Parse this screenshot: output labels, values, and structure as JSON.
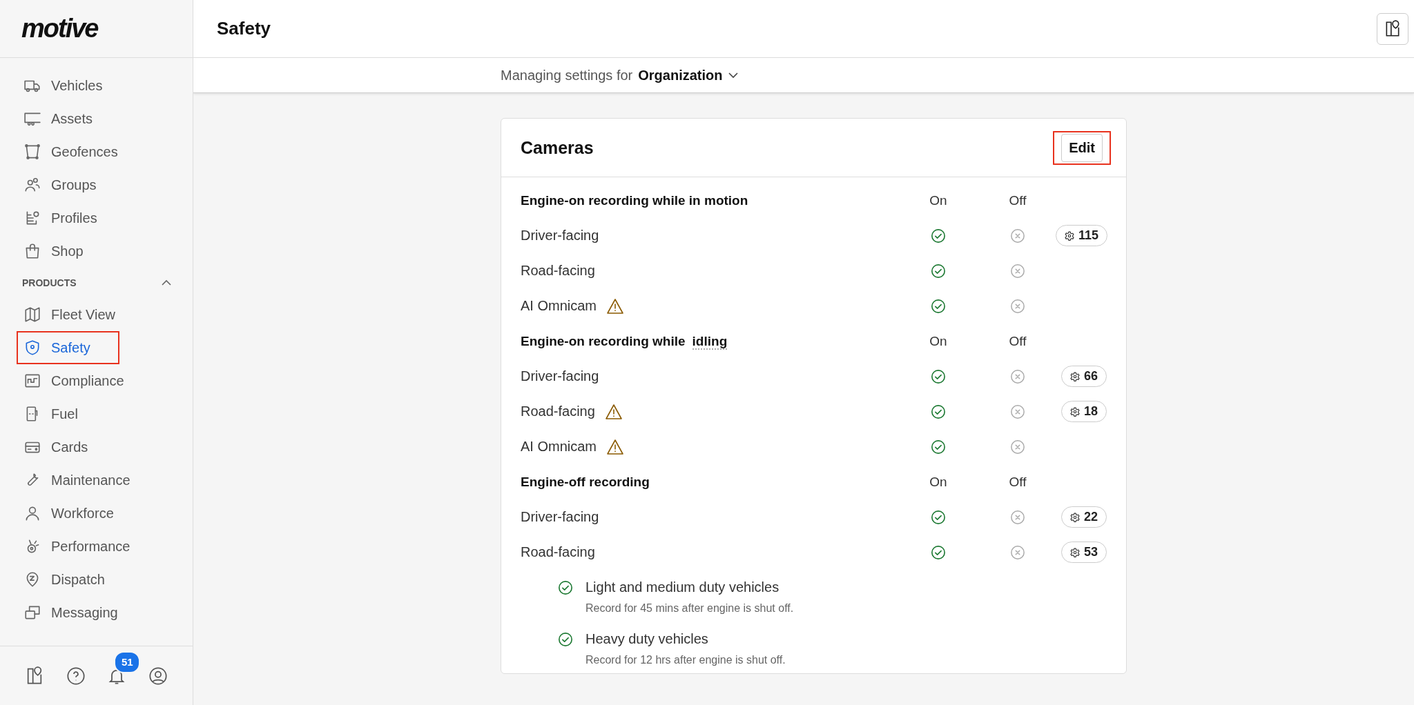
{
  "sidebar": {
    "logo": "motive",
    "items": [
      {
        "label": "Vehicles",
        "selected": false,
        "highlighted": false
      },
      {
        "label": "Assets",
        "selected": false,
        "highlighted": false
      },
      {
        "label": "Geofences",
        "selected": false,
        "highlighted": false
      },
      {
        "label": "Groups",
        "selected": false,
        "highlighted": false
      },
      {
        "label": "Profiles",
        "selected": false,
        "highlighted": false
      },
      {
        "label": "Shop",
        "selected": false,
        "highlighted": false
      }
    ],
    "section": {
      "title": "PRODUCTS",
      "expanded": true
    },
    "products": [
      {
        "label": "Fleet View",
        "selected": false,
        "highlighted": false
      },
      {
        "label": "Safety",
        "selected": true,
        "highlighted": true
      },
      {
        "label": "Compliance",
        "selected": false,
        "highlighted": false
      },
      {
        "label": "Fuel",
        "selected": false,
        "highlighted": false
      },
      {
        "label": "Cards",
        "selected": false,
        "highlighted": false
      },
      {
        "label": "Maintenance",
        "selected": false,
        "highlighted": false
      },
      {
        "label": "Workforce",
        "selected": false,
        "highlighted": false
      },
      {
        "label": "Performance",
        "selected": false,
        "highlighted": false
      },
      {
        "label": "Dispatch",
        "selected": false,
        "highlighted": false
      },
      {
        "label": "Messaging",
        "selected": false,
        "highlighted": false
      }
    ],
    "notification_count": "51"
  },
  "header": {
    "title": "Safety"
  },
  "scope": {
    "prefix": "Managing settings for",
    "value": "Organization"
  },
  "card": {
    "title": "Cameras",
    "edit_button": {
      "label": "Edit",
      "highlighted": true
    },
    "sections": [
      {
        "title": "Engine-on recording while in motion",
        "on_label": "On",
        "off_label": "Off",
        "rows": [
          {
            "label": "Driver-facing",
            "warning": false,
            "on": true,
            "count": "115"
          },
          {
            "label": "Road-facing",
            "warning": false,
            "on": true
          },
          {
            "label": "AI Omnicam",
            "warning": true,
            "on": true
          }
        ]
      },
      {
        "title": "Engine-on recording while",
        "term": "idling",
        "on_label": "On",
        "off_label": "Off",
        "rows": [
          {
            "label": "Driver-facing",
            "warning": false,
            "on": true,
            "count": "66"
          },
          {
            "label": "Road-facing",
            "warning": true,
            "on": true,
            "count": "18"
          },
          {
            "label": "AI Omnicam",
            "warning": true,
            "on": true
          }
        ]
      },
      {
        "title": "Engine-off recording",
        "on_label": "On",
        "off_label": "Off",
        "rows": [
          {
            "label": "Driver-facing",
            "warning": false,
            "on": true,
            "count": "22"
          },
          {
            "label": "Road-facing",
            "warning": false,
            "on": true,
            "count": "53"
          }
        ],
        "options": [
          {
            "label": "Light and medium duty vehicles",
            "description": "Record for 45 mins after engine is shut off.",
            "checked": true
          },
          {
            "label": "Heavy duty vehicles",
            "description": "Record for 12 hrs after engine is shut off.",
            "checked": true
          }
        ]
      }
    ]
  }
}
